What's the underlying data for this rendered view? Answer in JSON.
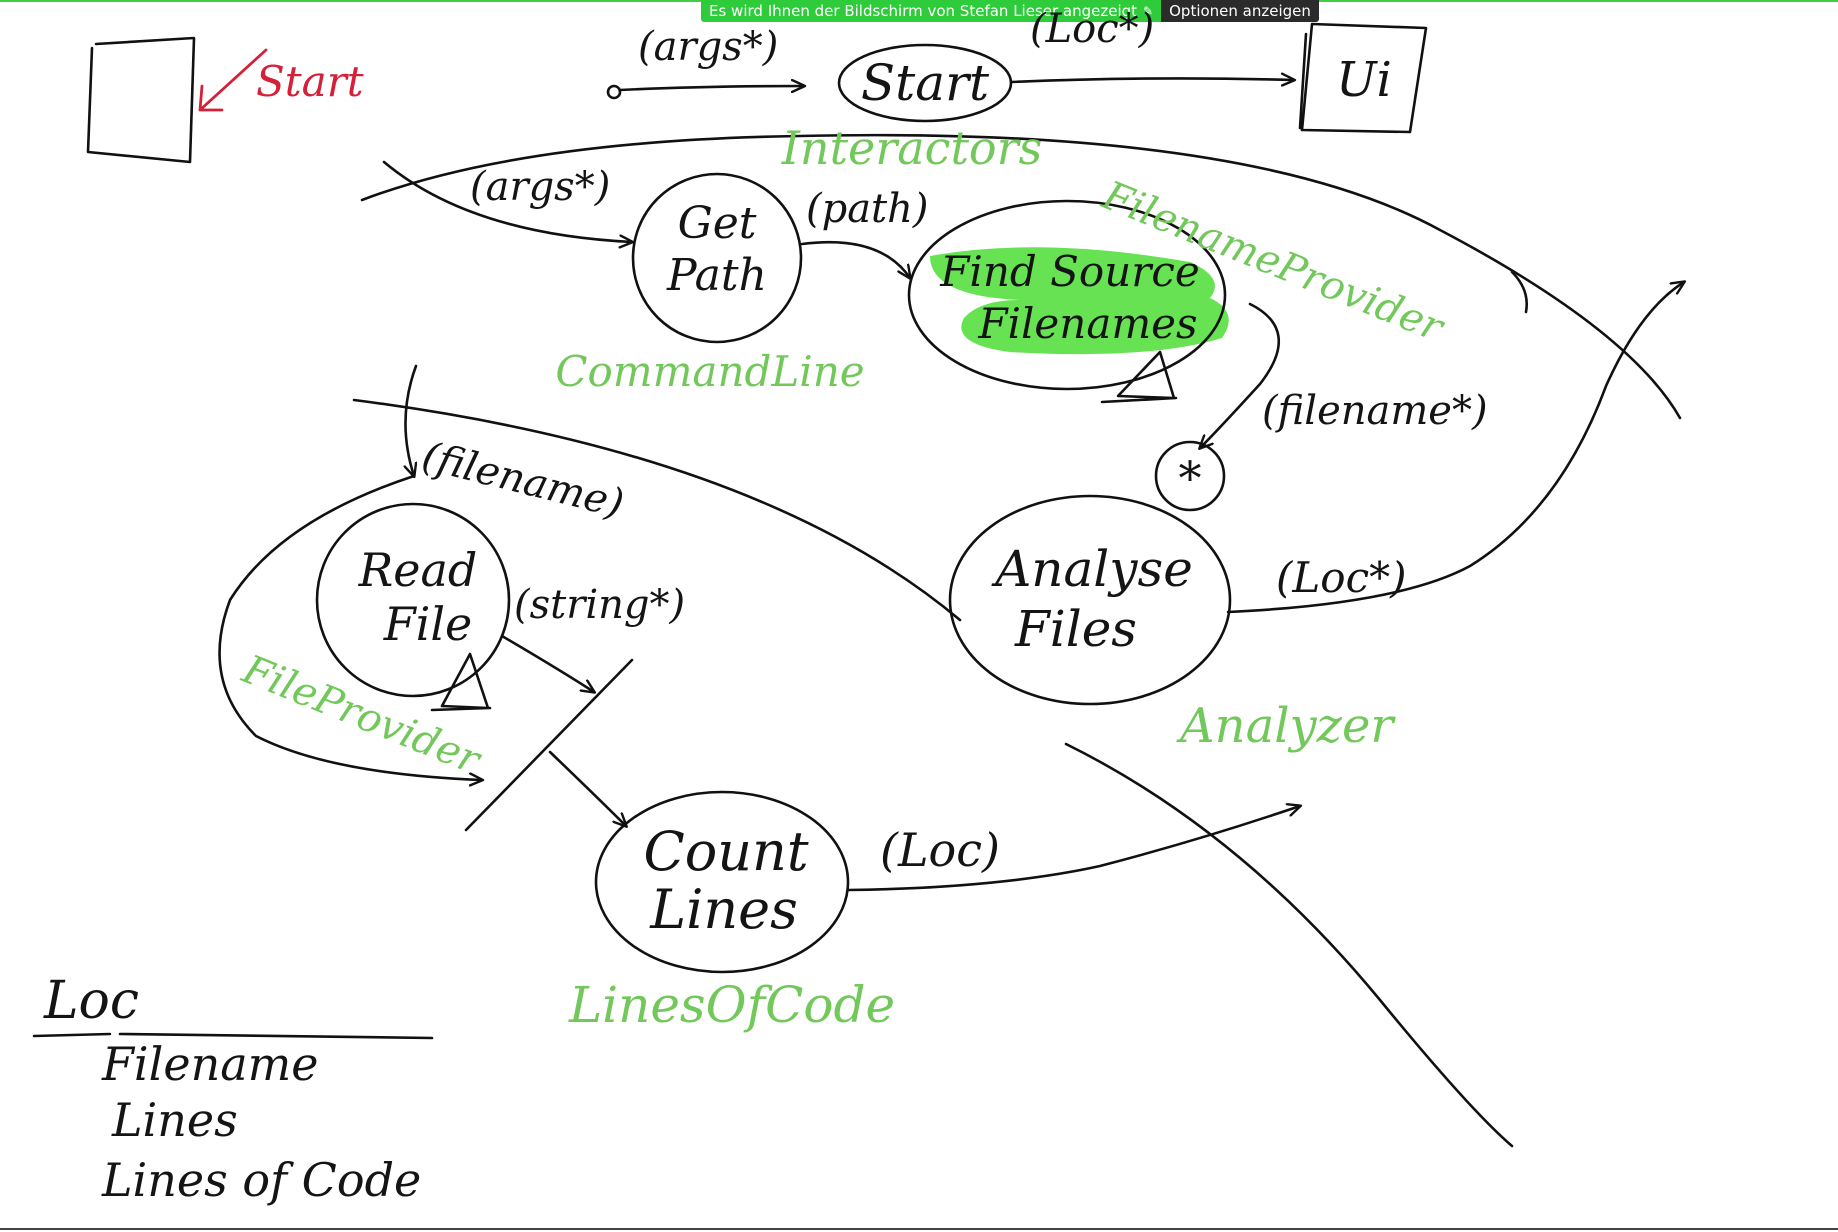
{
  "banner": {
    "message": "Es wird Ihnen der Bildschirm von Stefan Lieser angezeigt",
    "options_label": "Optionen anzeigen",
    "colors": {
      "banner": "#2ecc3a",
      "options": "#2b2b2b"
    }
  },
  "start_marker": {
    "label": "Start"
  },
  "nodes": {
    "start": "Start",
    "ui": "Ui",
    "get_path": [
      "Get",
      "Path"
    ],
    "find_source": [
      "Find Source",
      "Filenames"
    ],
    "analyse": [
      "Analyse",
      "Files"
    ],
    "read_file": [
      "Read",
      "File"
    ],
    "count_lines": [
      "Count",
      "Lines"
    ],
    "split_symbol": "*"
  },
  "flows": {
    "args_top": "(args*)",
    "loc_top": "(Loc*)",
    "args_mid": "(args*)",
    "path": "(path)",
    "filename_star": "(filename*)",
    "filename": "(filename)",
    "string_star": "(string*)",
    "loc_right": "(Loc*)",
    "loc": "(Loc)"
  },
  "modules": {
    "interactors": "Interactors",
    "filename_provider": "FilenameProvider",
    "command_line": "CommandLine",
    "file_provider": "FileProvider",
    "analyzer": "Analyzer",
    "lines_of_code": "LinesOfCode"
  },
  "data_type": {
    "name": "Loc",
    "fields": [
      "Filename",
      "Lines",
      "Lines of Code"
    ]
  },
  "colors": {
    "ink": "#141414",
    "module_label": "#72c85a",
    "highlight": "#5ee04a",
    "start_marker": "#d4213a"
  }
}
